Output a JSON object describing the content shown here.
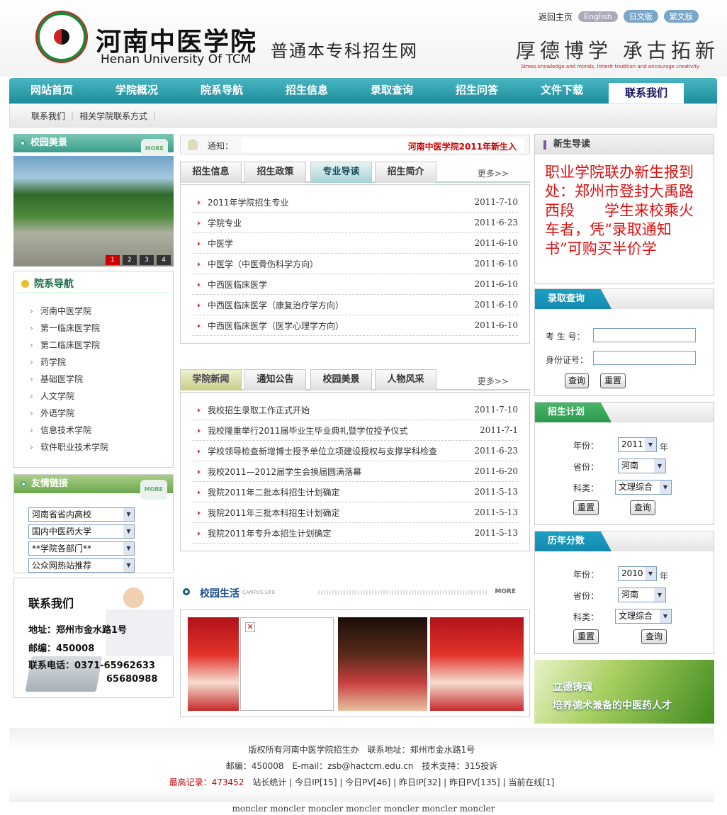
{
  "header": {
    "logo_seal_text": "河南中医学院",
    "logo_cn": "河南中医学院",
    "logo_en": "Henan University Of TCM",
    "site_title": "普通本专科招生网",
    "top_links": {
      "home": "返回主页",
      "english": "English",
      "japanese": "日文版",
      "traditional": "繁文版"
    },
    "motto": "厚德博学 承古拓新",
    "motto_en": "Stress knowledge and morals, inherit tradition and encourage creativity"
  },
  "nav": {
    "items": [
      "网站首页",
      "学院概况",
      "院系导航",
      "招生信息",
      "录取查询",
      "招生问答",
      "文件下载",
      "联系我们"
    ],
    "active": "联系我们"
  },
  "subnav": {
    "items": [
      "联系我们",
      "相关学院联系方式"
    ]
  },
  "left": {
    "campus_title": "校园美景",
    "more": "MORE",
    "pager": [
      "1",
      "2",
      "3",
      "4"
    ],
    "dept_title": "院系导航",
    "dept_items": [
      "河南中医学院",
      "第一临床医学院",
      "第二临床医学院",
      "药学院",
      "基础医学院",
      "人文学院",
      "外语学院",
      "信息技术学院",
      "软件职业技术学院"
    ],
    "friend_title": "友情链接",
    "friend_selects": [
      "河南省省内高校",
      "国内中医药大学",
      "**学院各部门**",
      "公众网热站推荐"
    ],
    "contact": {
      "title": "联系我们",
      "address": "地址：郑州市金水路1号",
      "zip": "邮编：450008",
      "phone": "联系电话：0371-65962633",
      "phone2": "65680988"
    }
  },
  "middle": {
    "notice_label": "通知：",
    "notice_text": "河南中医学院2011年新生入",
    "tabs1": [
      "招生信息",
      "招生政策",
      "专业导读",
      "招生简介"
    ],
    "tabs1_active": "专业导读",
    "more_link": "更多>>",
    "list1": [
      {
        "title": "2011年学院招生专业",
        "date": "2011-7-10"
      },
      {
        "title": "学院专业",
        "date": "2011-6-23"
      },
      {
        "title": "中医学",
        "date": "2011-6-10"
      },
      {
        "title": "中医学（中医骨伤科学方向）",
        "date": "2011-6-10"
      },
      {
        "title": "中西医临床医学",
        "date": "2011-6-10"
      },
      {
        "title": "中西医临床医学（康复治疗学方向）",
        "date": "2011-6-10"
      },
      {
        "title": "中西医临床医学（医学心理学方向）",
        "date": "2011-6-10"
      }
    ],
    "tabs2": [
      "学院新闻",
      "通知公告",
      "校园美景",
      "人物风采"
    ],
    "tabs2_active": "学院新闻",
    "list2": [
      {
        "title": "我校招生录取工作正式开始",
        "date": "2011-7-10"
      },
      {
        "title": "我校隆重举行2011届毕业生毕业典礼暨学位授予仪式",
        "date": "2011-7-1"
      },
      {
        "title": "学校领导检查新增博士授予单位立项建设授权与支撑学科检查",
        "date": "2011-6-23"
      },
      {
        "title": "我校2011—2012届学生会换届圆满落幕",
        "date": "2011-6-20"
      },
      {
        "title": "我院2011年二批本科招生计划确定",
        "date": "2011-5-13"
      },
      {
        "title": "我院2011年三批本科招生计划确定",
        "date": "2011-5-13"
      },
      {
        "title": "我院2011年专升本招生计划确定",
        "date": "2011-5-13"
      }
    ],
    "life_title": "校园生活",
    "life_en": "CAMPUS LIFE",
    "life_more": "MORE"
  },
  "right": {
    "news_read_title": "新生导读",
    "news_read_text": "职业学院联办新生报到处：郑州市登封大禹路西段　　学生来校乘火车者，凭“录取通知书”可购买半价学",
    "admission_query": {
      "title": "录取查询",
      "exam_no_label": "考 生 号：",
      "id_label": "身份证号：",
      "query": "查询",
      "reset": "重置"
    },
    "plan": {
      "title": "招生计划",
      "year_label": "年份：",
      "year": "2011",
      "year_unit": "年",
      "province_label": "省份：",
      "province": "河南",
      "subject_label": "科类：",
      "subject": "文理综合",
      "reset": "重置",
      "query": "查询"
    },
    "scores": {
      "title": "历年分数",
      "year_label": "年份：",
      "year": "2010",
      "year_unit": "年",
      "province_label": "省份：",
      "province": "河南",
      "subject_label": "科类：",
      "subject": "文理综合",
      "reset": "重置",
      "query": "查询"
    },
    "banner_line1": "立德铸魂",
    "banner_line2": "培养德术兼备的中医药人才"
  },
  "footer": {
    "line1": "版权所有河南中医学院招生办　联系地址：郑州市金水路1号",
    "line2": "邮编：450008　E-mail：zsb@hactcm.edu.cn　技术支持：315投诉",
    "record_label": "最高记录：",
    "record_value": "473452",
    "stats": "　站长统计 | 今日IP[15] | 今日PV[46] | 昨日IP[32] | 昨日PV[135] | 当前在线[1]",
    "bottom": "moncler moncler moncler moncler moncler moncler moncler"
  },
  "colors": {
    "nav": "#2a9fae",
    "accent_red": "#e01010",
    "green_header": "#3a9e8a"
  }
}
